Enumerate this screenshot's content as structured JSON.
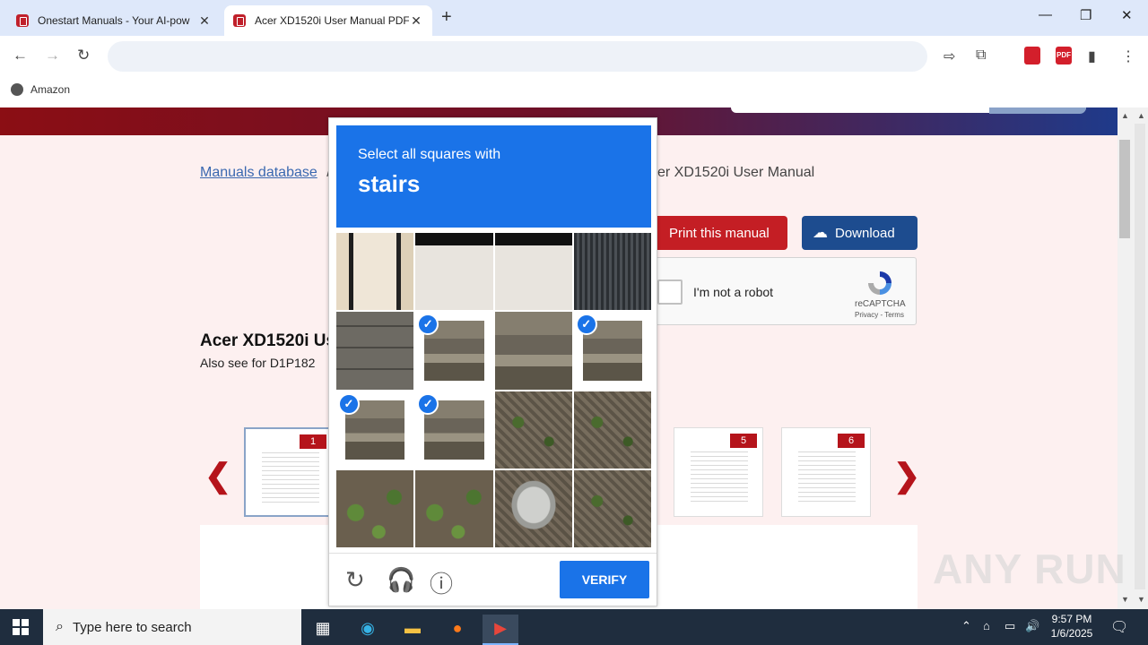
{
  "browser": {
    "tabs": [
      {
        "title": "Onestart Manuals - Your AI-pow",
        "active": false
      },
      {
        "title": "Acer XD1520i User Manual PDF",
        "active": true
      }
    ],
    "address": "",
    "bookmarks": [
      {
        "label": "Amazon"
      }
    ]
  },
  "page": {
    "breadcrumb_link": "Manuals database",
    "breadcrumb_sep": "/",
    "breadcrumb_end": "er XD1520i User Manual",
    "print_label": "Print this manual",
    "download_label": "Download",
    "manual_title": "Acer XD1520i Us",
    "also_see": "Also see for D1P182",
    "thumbnails": [
      {
        "num": "1"
      },
      {
        "num": "5"
      },
      {
        "num": "6"
      }
    ]
  },
  "recaptcha": {
    "label": "I'm not a robot",
    "brand": "reCAPTCHA",
    "terms": "Privacy - Terms"
  },
  "challenge": {
    "prompt": "Select all squares with",
    "word": "stairs",
    "verify": "VERIFY",
    "grid": [
      {
        "tex": "t-wall",
        "selected": false
      },
      {
        "tex": "t-window",
        "selected": false
      },
      {
        "tex": "t-window",
        "selected": false
      },
      {
        "tex": "t-shutter",
        "selected": false
      },
      {
        "tex": "t-block",
        "selected": false
      },
      {
        "tex": "t-stairs",
        "selected": true
      },
      {
        "tex": "t-stairs",
        "selected": false
      },
      {
        "tex": "t-stairs",
        "selected": true
      },
      {
        "tex": "t-stairs",
        "selected": true
      },
      {
        "tex": "t-stairs",
        "selected": true
      },
      {
        "tex": "t-ground",
        "selected": false
      },
      {
        "tex": "t-ground",
        "selected": false
      },
      {
        "tex": "t-plants",
        "selected": false
      },
      {
        "tex": "t-plants",
        "selected": false
      },
      {
        "tex": "t-pot",
        "selected": false
      },
      {
        "tex": "t-ground",
        "selected": false
      }
    ]
  },
  "taskbar": {
    "search_placeholder": "Type here to search",
    "time": "9:57 PM",
    "date": "1/6/2025"
  },
  "watermark": "ANY RUN",
  "colors": {
    "captcha_blue": "#1a73e8",
    "brand_red": "#c41e24",
    "brand_navy": "#1d4c8f"
  }
}
